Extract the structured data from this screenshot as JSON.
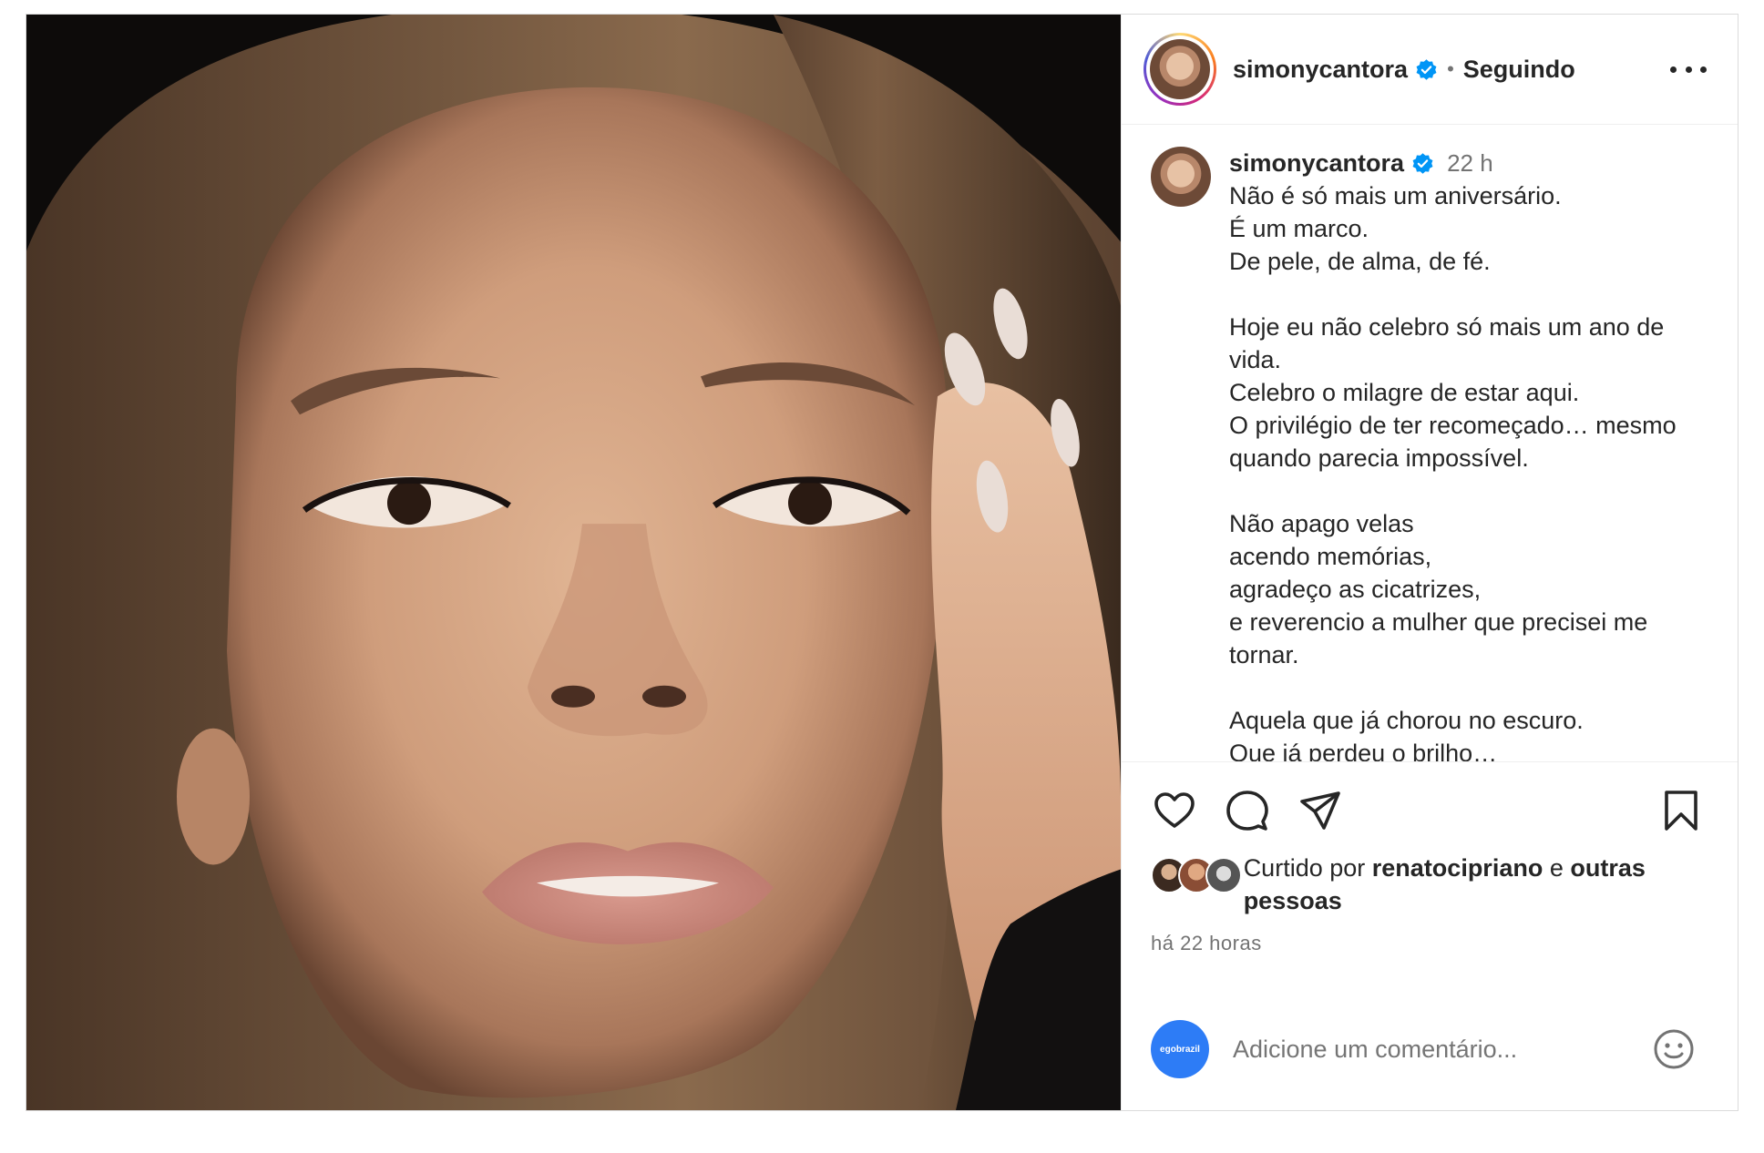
{
  "header": {
    "username": "simonycantora",
    "separator": "•",
    "follow_status": "Seguindo"
  },
  "caption": {
    "username": "simonycantora",
    "time": "22 h",
    "text": "Não é só mais um aniversário.\nÉ um marco.\nDe pele, de alma, de fé.\n\nHoje eu não celebro só mais um ano de vida.\nCelebro o milagre de estar aqui.\nO privilégio de ter recomeçado… mesmo quando parecia impossível.\n\nNão apago velas\nacendo memórias,\nagradeço as cicatrizes,\ne reverencio a mulher que precisei me tornar.\n\nAquela que já chorou no escuro.\nQue já perdeu o brilho…\nmas nunca a luz."
  },
  "likes": {
    "prefix": "Curtido por",
    "user": "renatocipriano",
    "conjunction": "e",
    "others": "outras pessoas"
  },
  "timestamp": "há 22 horas",
  "comment": {
    "placeholder": "Adicione um comentário...",
    "me_avatar_label": "egobrazil"
  },
  "icons": {
    "like": "heart-icon",
    "comment": "comment-icon",
    "share": "share-icon",
    "save": "bookmark-icon",
    "verified": "verified-badge-icon",
    "emoji": "emoji-icon",
    "more": "more-options-icon"
  },
  "colors": {
    "verified": "#0095f6",
    "secondary_text": "#737373",
    "primary_text": "#262626",
    "me_avatar": "#2d7cf6"
  }
}
